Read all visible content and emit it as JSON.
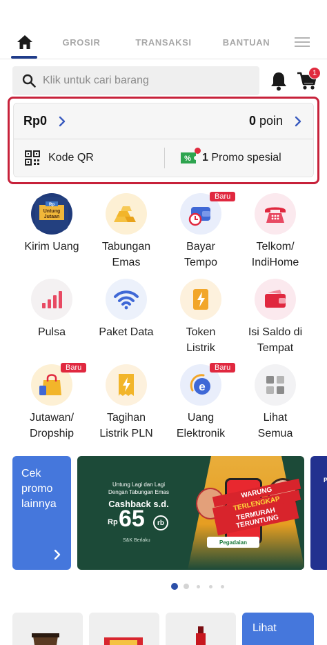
{
  "tabs": {
    "home_icon": "home-icon",
    "grosir": "GROSIR",
    "transaksi": "TRANSAKSI",
    "bantuan": "BANTUAN",
    "menu_icon": "hamburger-icon"
  },
  "search": {
    "placeholder": "Klik untuk cari barang",
    "cart_count": "1"
  },
  "wallet": {
    "balance": "Rp0",
    "points_value": "0",
    "points_unit": "poin",
    "qr_label": "Kode QR",
    "promo_count": "1",
    "promo_label": "Promo spesial"
  },
  "menu": [
    {
      "line1": "Kirim Uang",
      "line2": "",
      "icon": "untung-jutaan-icon",
      "badge": ""
    },
    {
      "line1": "Tabungan",
      "line2": "Emas",
      "icon": "gold-bar-icon",
      "badge": ""
    },
    {
      "line1": "Bayar",
      "line2": "Tempo",
      "icon": "wallet-clock-icon",
      "badge": "Baru"
    },
    {
      "line1": "Telkom/",
      "line2": "IndiHome",
      "icon": "telephone-icon",
      "badge": ""
    },
    {
      "line1": "Pulsa",
      "line2": "",
      "icon": "signal-bars-icon",
      "badge": ""
    },
    {
      "line1": "Paket Data",
      "line2": "",
      "icon": "wifi-icon",
      "badge": ""
    },
    {
      "line1": "Token",
      "line2": "Listrik",
      "icon": "lightning-token-icon",
      "badge": ""
    },
    {
      "line1": "Isi Saldo di",
      "line2": "Tempat",
      "icon": "wallet-icon",
      "badge": ""
    },
    {
      "line1": "Jutawan/",
      "line2": "Dropship",
      "icon": "shopping-bag-icon",
      "badge": "Baru"
    },
    {
      "line1": "Tagihan",
      "line2": "Listrik PLN",
      "icon": "electric-bill-icon",
      "badge": ""
    },
    {
      "line1": "Uang",
      "line2": "Elektronik",
      "icon": "e-money-icon",
      "badge": "Baru"
    },
    {
      "line1": "Lihat",
      "line2": "Semua",
      "icon": "grid-icon",
      "badge": ""
    }
  ],
  "promo_banner": {
    "side_line1": "Cek",
    "side_line2": "promo",
    "side_line3": "lainnya",
    "tagline1": "Untung Lagi dan Lagi",
    "tagline2": "Dengan Tabungan Emas",
    "cashback": "Cashback s.d.",
    "currency": "Rp",
    "amount": "65",
    "unit": "rb",
    "terms": "S&K Berlaku",
    "sign1": "WARUNG",
    "sign2": "TERLENGKAP",
    "sign3": "TERMURAH TERUNTUNG",
    "partner": "Pegadaian",
    "untung_badge_line1": "Untung",
    "untung_badge_line2": "Jutaan"
  },
  "carousel": {
    "total": 5,
    "active": 0
  },
  "products": {
    "see_all": "Lihat"
  },
  "colors": {
    "brand_navy": "#1f3c8a",
    "accent_red": "#c7213a",
    "badge_red": "#e0283f",
    "promo_blue": "#4577dc",
    "banner_green": "#1c4a38"
  }
}
